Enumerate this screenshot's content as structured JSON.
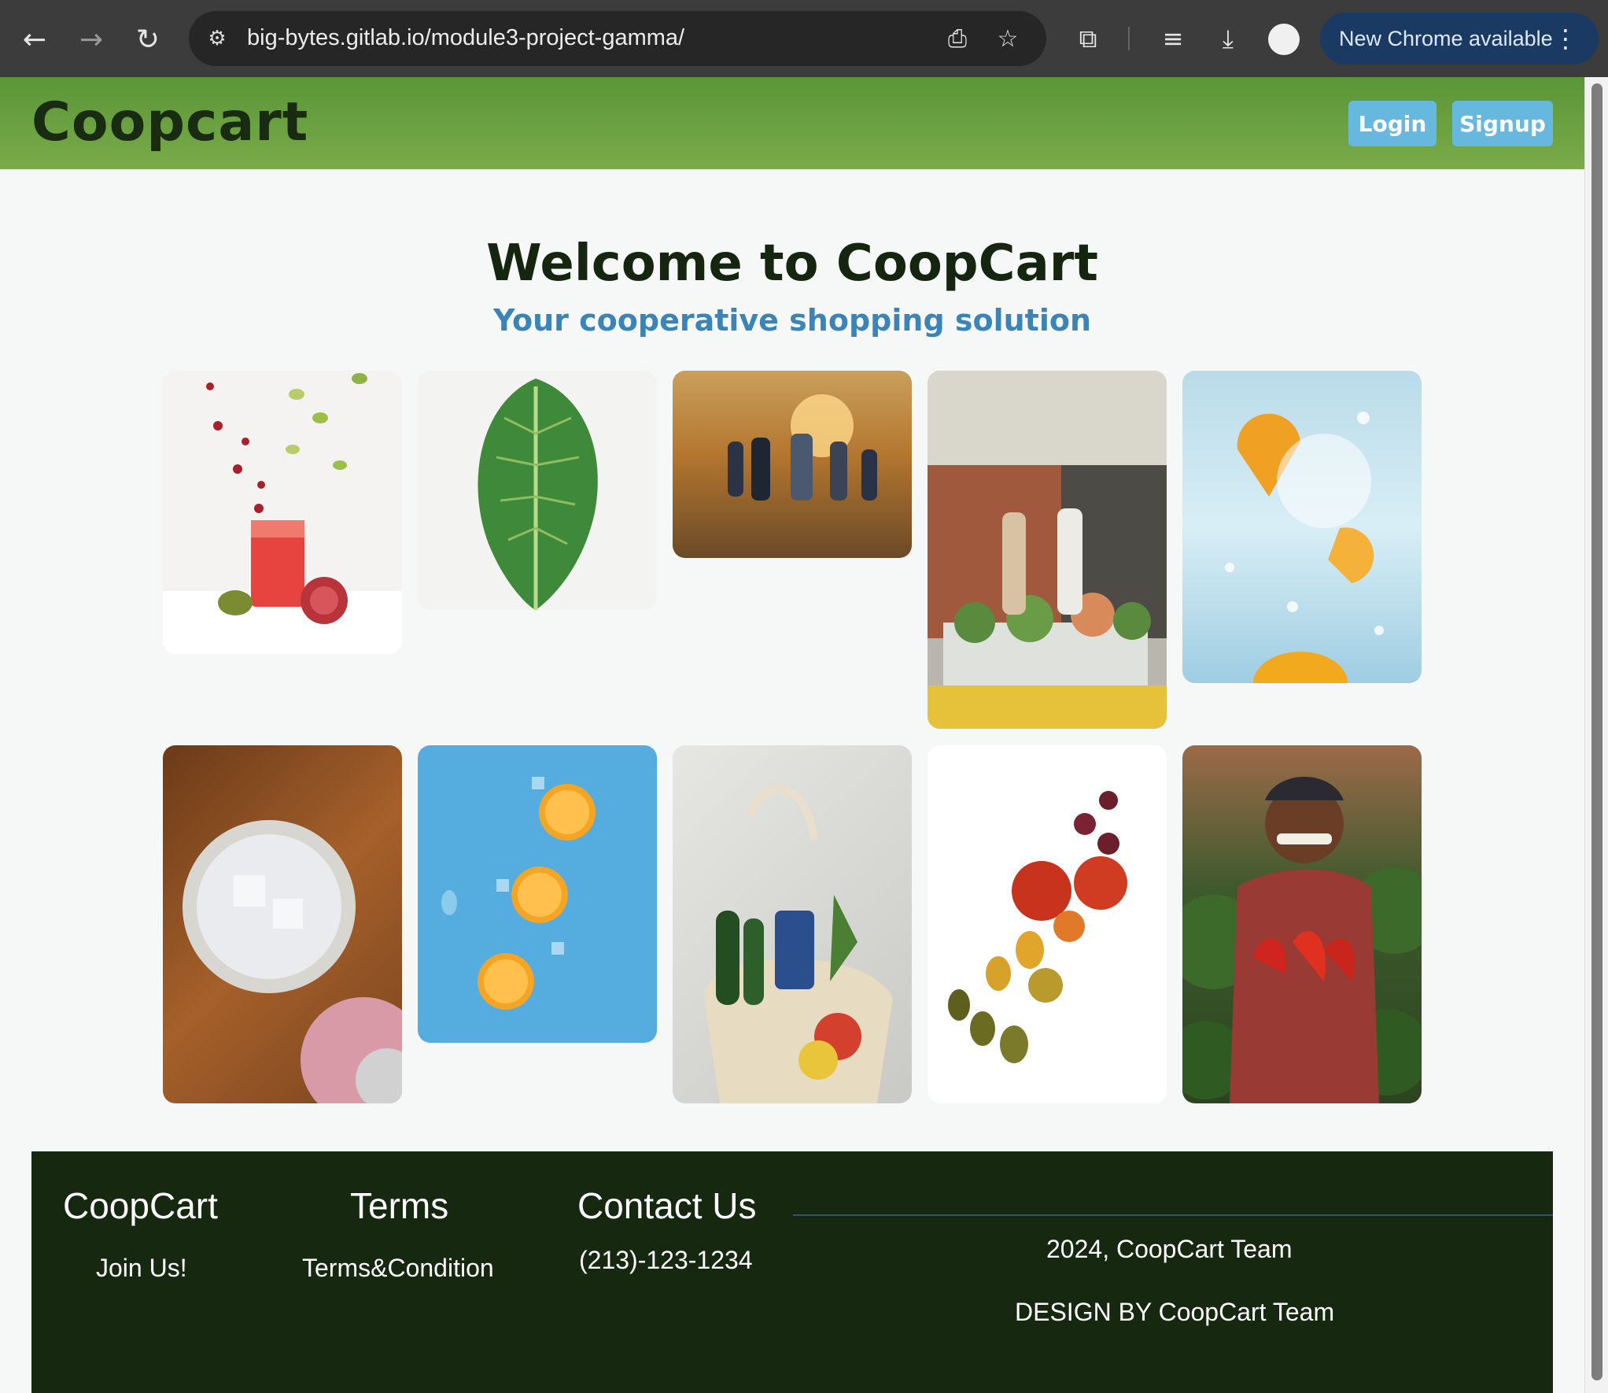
{
  "browser": {
    "url": "big-bytes.gitlab.io/module3-project-gamma/",
    "update_label": "New Chrome available",
    "icons": [
      "back-arrow-icon",
      "forward-arrow-icon",
      "reload-icon",
      "site-info-icon",
      "install-app-icon",
      "bookmark-star-icon",
      "extensions-icon",
      "media-controls-icon",
      "download-icon",
      "profile-avatar",
      "more-menu-icon"
    ]
  },
  "header": {
    "brand": "Coopcart",
    "login_label": "Login",
    "signup_label": "Signup"
  },
  "hero": {
    "title": "Welcome to CoopCart",
    "subtitle": "Your cooperative shopping solution"
  },
  "gallery": [
    {
      "subject": "red smoothie with falling fruit"
    },
    {
      "subject": "kale leaf on white brick"
    },
    {
      "subject": "people walking in desert at sunset"
    },
    {
      "subject": "flower stand at storefront"
    },
    {
      "subject": "orange slices in sparkling water"
    },
    {
      "subject": "glass of ice water on wood"
    },
    {
      "subject": "orange slices on blue background"
    },
    {
      "subject": "mesh bag with groceries"
    },
    {
      "subject": "assorted tomatoes on white"
    },
    {
      "subject": "farmer holding red peppers"
    }
  ],
  "footer": {
    "col1_heading": "CoopCart",
    "col1_link": "Join Us!",
    "col2_heading": "Terms",
    "col2_link": "Terms&Condition",
    "col3_heading": "Contact Us",
    "col3_phone": "(213)-123-1234",
    "copyright": "2024, CoopCart Team",
    "design_credit": "DESIGN BY CoopCart Team"
  },
  "colors": {
    "header_green": "#6aa040",
    "footer_dark": "#162810",
    "button_blue": "#66b8de",
    "subtitle_blue": "#3a84b8"
  }
}
